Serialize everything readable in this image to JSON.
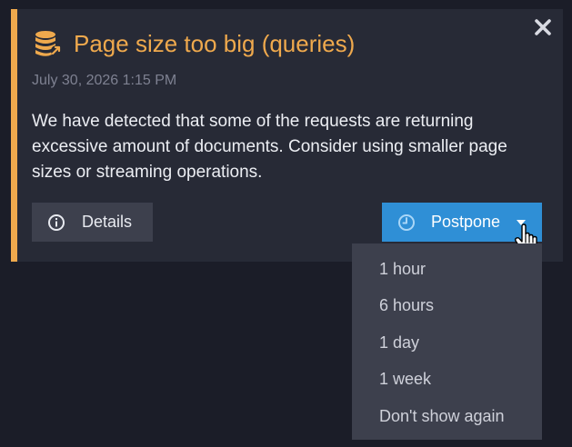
{
  "notification": {
    "title": "Page size too big (queries)",
    "date": "July 30, 2026 1:15 PM",
    "message": "We have detected that some of the requests are returning excessive amount of documents. Consider using smaller page sizes or streaming operations.",
    "icon": "database-icon",
    "accent_color": "#efa94d"
  },
  "actions": {
    "details_label": "Details",
    "postpone_label": "Postpone",
    "postpone_color": "#2f8fd6"
  },
  "postpone_menu": {
    "items": [
      {
        "label": "1 hour"
      },
      {
        "label": "6 hours"
      },
      {
        "label": "1 day"
      },
      {
        "label": "1 week"
      },
      {
        "label": "Don't show again"
      }
    ]
  }
}
